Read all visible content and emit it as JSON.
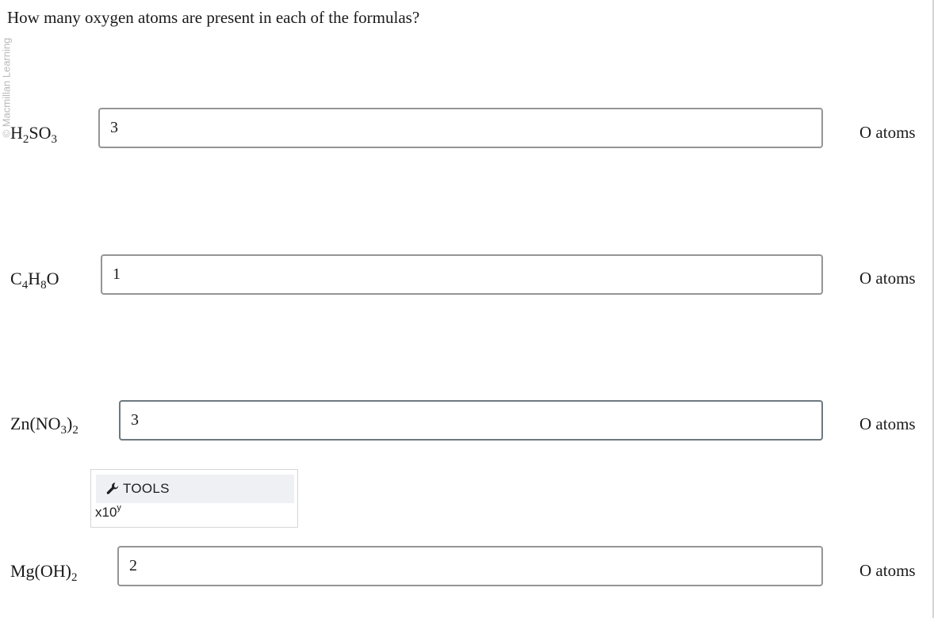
{
  "question": "How many oxygen atoms are present in each of the formulas?",
  "side_watermark": "© Macmillan Learning",
  "rows": [
    {
      "formula": [
        {
          "t": "H"
        },
        {
          "sub": "2"
        },
        {
          "t": "SO"
        },
        {
          "sub": "3"
        }
      ],
      "answer": "3",
      "unit": "O atoms"
    },
    {
      "formula": [
        {
          "t": "C"
        },
        {
          "sub": "4"
        },
        {
          "t": "H"
        },
        {
          "sub": "8"
        },
        {
          "t": "O"
        }
      ],
      "answer": "1",
      "unit": "O atoms"
    },
    {
      "formula": [
        {
          "t": "Zn(NO"
        },
        {
          "sub": "3"
        },
        {
          "t": ")"
        },
        {
          "sub": "2"
        }
      ],
      "answer": "3",
      "unit": "O atoms"
    },
    {
      "formula": [
        {
          "t": "Mg(OH)"
        },
        {
          "sub": "2"
        }
      ],
      "answer": "2",
      "unit": "O atoms"
    }
  ],
  "tools": {
    "icon": "wrench-icon",
    "label": "TOOLS",
    "sci_base": "x10",
    "sci_exp": "y"
  },
  "colors": {
    "input_border": "#959595",
    "tools_header_bg": "#eef0f3"
  }
}
